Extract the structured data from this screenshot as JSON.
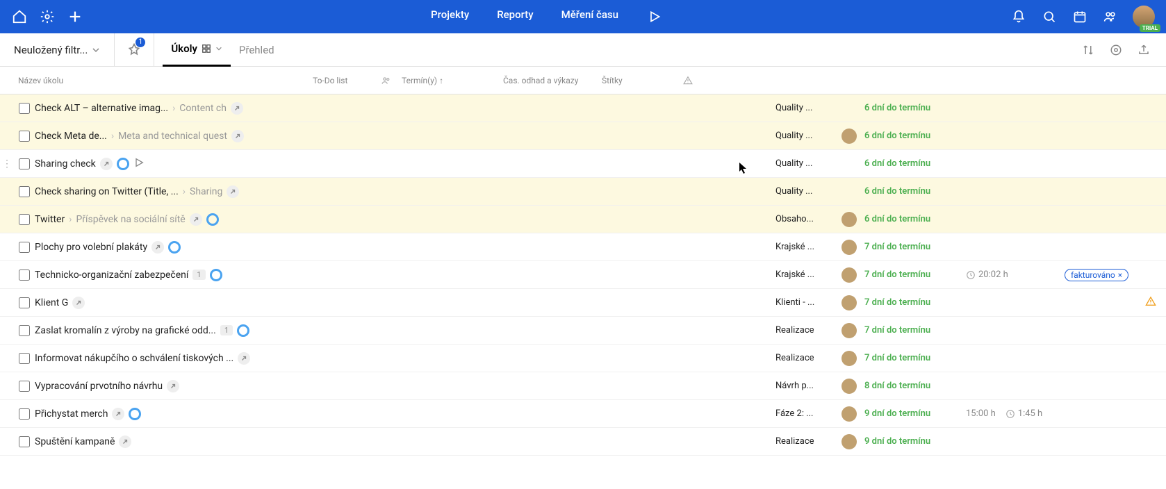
{
  "topbar": {
    "nav": {
      "projekty": "Projekty",
      "reporty": "Reporty",
      "mereni": "Měření času"
    },
    "trial": "TRIAL"
  },
  "filterbar": {
    "filter_name": "Neuložený filtr...",
    "pin_count": "1",
    "tabs": {
      "ukoly": "Úkoly",
      "prehled": "Přehled"
    }
  },
  "columns": {
    "name": "Název úkolu",
    "todo": "To-Do list",
    "term": "Termín(y) ↑",
    "time": "Čas. odhad a výkazy",
    "tags": "Štítky"
  },
  "rows": [
    {
      "title": "Check ALT – alternative imag...",
      "crumb": "Content ch",
      "todo": "Quality ...",
      "term": "6 dní do termínu",
      "highlighted": true,
      "link_icon": true
    },
    {
      "title": "Check Meta de...",
      "crumb": "Meta and technical quest",
      "todo": "Quality ...",
      "term": "6 dní do termínu",
      "highlighted": true,
      "link_icon": true,
      "assignee": true
    },
    {
      "title": "Sharing check",
      "todo": "Quality ...",
      "term": "6 dní do termínu",
      "hovered": true,
      "handle": true,
      "link_icon": true,
      "status_ring": true,
      "play": true
    },
    {
      "title": "Check sharing on Twitter (Title, ...",
      "crumb": "Sharing",
      "todo": "Quality ...",
      "term": "6 dní do termínu",
      "highlighted": true,
      "link_icon": true
    },
    {
      "title": "Twitter",
      "crumb": "Příspěvek na sociální sítě",
      "todo": "Obsaho...",
      "term": "6 dní do termínu",
      "highlighted": true,
      "link_icon": true,
      "status_ring": true,
      "assignee": true
    },
    {
      "title": "Plochy pro volební plakáty",
      "todo": "Krajské ...",
      "term": "7 dní do termínu",
      "link_icon": true,
      "status_ring": true,
      "assignee": true
    },
    {
      "title": "Technicko-organizační zabezpečení",
      "count": "1",
      "todo": "Krajské ...",
      "term": "7 dní do termínu",
      "status_ring": true,
      "assignee": true,
      "time2": "20:02 h",
      "tag": "fakturováno"
    },
    {
      "title": "Klient G",
      "todo": "Klienti - ...",
      "term": "7 dní do termínu",
      "link_icon": true,
      "assignee": true,
      "warn": true
    },
    {
      "title": "Zaslat kromalín z výroby na grafické odd...",
      "count": "1",
      "todo": "Realizace",
      "term": "7 dní do termínu",
      "status_ring": true,
      "assignee": true
    },
    {
      "title": "Informovat nákupčího o schválení tiskových ...",
      "todo": "Realizace",
      "term": "7 dní do termínu",
      "link_icon": true,
      "assignee": true
    },
    {
      "title": "Vypracování prvotního návrhu",
      "todo": "Návrh p...",
      "term": "8 dní do termínu",
      "link_icon": true,
      "assignee": true
    },
    {
      "title": "Přichystat merch",
      "todo": "Fáze 2: ...",
      "term": "9 dní do termínu",
      "link_icon": true,
      "status_ring": true,
      "assignee": true,
      "time1": "15:00 h",
      "time2": "1:45 h"
    },
    {
      "title": "Spuštění kampaně",
      "todo": "Realizace",
      "term": "9 dní do termínu",
      "link_icon": true,
      "assignee": true
    }
  ]
}
